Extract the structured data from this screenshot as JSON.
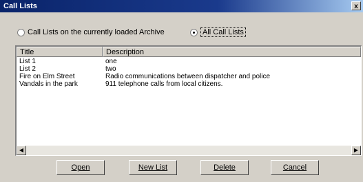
{
  "window": {
    "title": "Call Lists",
    "close_glyph": "x"
  },
  "filter": {
    "option_loaded": "Call Lists on the currently loaded Archive",
    "option_all": "All Call Lists",
    "selected": "all"
  },
  "list": {
    "columns": [
      "Title",
      "Description"
    ],
    "rows": [
      {
        "title": "List 1",
        "description": "one"
      },
      {
        "title": "List 2",
        "description": "two"
      },
      {
        "title": "Fire on Elm Street",
        "description": "Radio communications between dispatcher and police"
      },
      {
        "title": "Vandals in the park",
        "description": "911 telephone calls from local citizens."
      }
    ]
  },
  "buttons": {
    "open": "Open",
    "new_list": "New List",
    "delete": "Delete",
    "cancel": "Cancel"
  }
}
